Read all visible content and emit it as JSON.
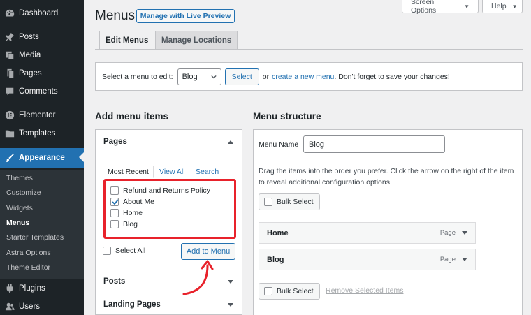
{
  "sidebar": {
    "items": [
      {
        "label": "Dashboard",
        "icon": "dashboard-icon"
      },
      {
        "label": "Posts",
        "icon": "pin-icon"
      },
      {
        "label": "Media",
        "icon": "media-icon"
      },
      {
        "label": "Pages",
        "icon": "pages-icon"
      },
      {
        "label": "Comments",
        "icon": "comments-icon"
      },
      {
        "label": "Elementor",
        "icon": "elementor-icon"
      },
      {
        "label": "Templates",
        "icon": "folder-icon"
      },
      {
        "label": "Appearance",
        "icon": "brush-icon"
      },
      {
        "label": "Plugins",
        "icon": "plugin-icon"
      },
      {
        "label": "Users",
        "icon": "users-icon"
      }
    ],
    "submenu": [
      "Themes",
      "Customize",
      "Widgets",
      "Menus",
      "Starter Templates",
      "Astra Options",
      "Theme Editor"
    ]
  },
  "header": {
    "title": "Menus",
    "live_preview": "Manage with Live Preview",
    "screen_options": "Screen Options",
    "help": "Help"
  },
  "tabs": [
    "Edit Menus",
    "Manage Locations"
  ],
  "select_bar": {
    "label": "Select a menu to edit:",
    "value": "Blog",
    "button": "Select",
    "or": "or",
    "create_link": "create a new menu",
    "suffix": ". Don't forget to save your changes!"
  },
  "add_items": {
    "heading": "Add menu items",
    "pages_title": "Pages",
    "subtabs": [
      "Most Recent",
      "View All",
      "Search"
    ],
    "pages": [
      {
        "label": "Refund and Returns Policy",
        "checked": false
      },
      {
        "label": "About Me",
        "checked": true
      },
      {
        "label": "Home",
        "checked": false
      },
      {
        "label": "Blog",
        "checked": false
      }
    ],
    "select_all": "Select All",
    "add_button": "Add to Menu",
    "posts_title": "Posts",
    "landing_title": "Landing Pages"
  },
  "structure": {
    "heading": "Menu structure",
    "name_label": "Menu Name",
    "name_value": "Blog",
    "description": "Drag the items into the order you prefer. Click the arrow on the right of the item to reveal additional configuration options.",
    "bulk_select": "Bulk Select",
    "items": [
      {
        "title": "Home",
        "type": "Page"
      },
      {
        "title": "Blog",
        "type": "Page"
      }
    ],
    "remove_selected": "Remove Selected Items"
  },
  "colors": {
    "sidebar_bg": "#1d2327",
    "accent": "#2271b1",
    "highlight_border": "#e8222b"
  }
}
